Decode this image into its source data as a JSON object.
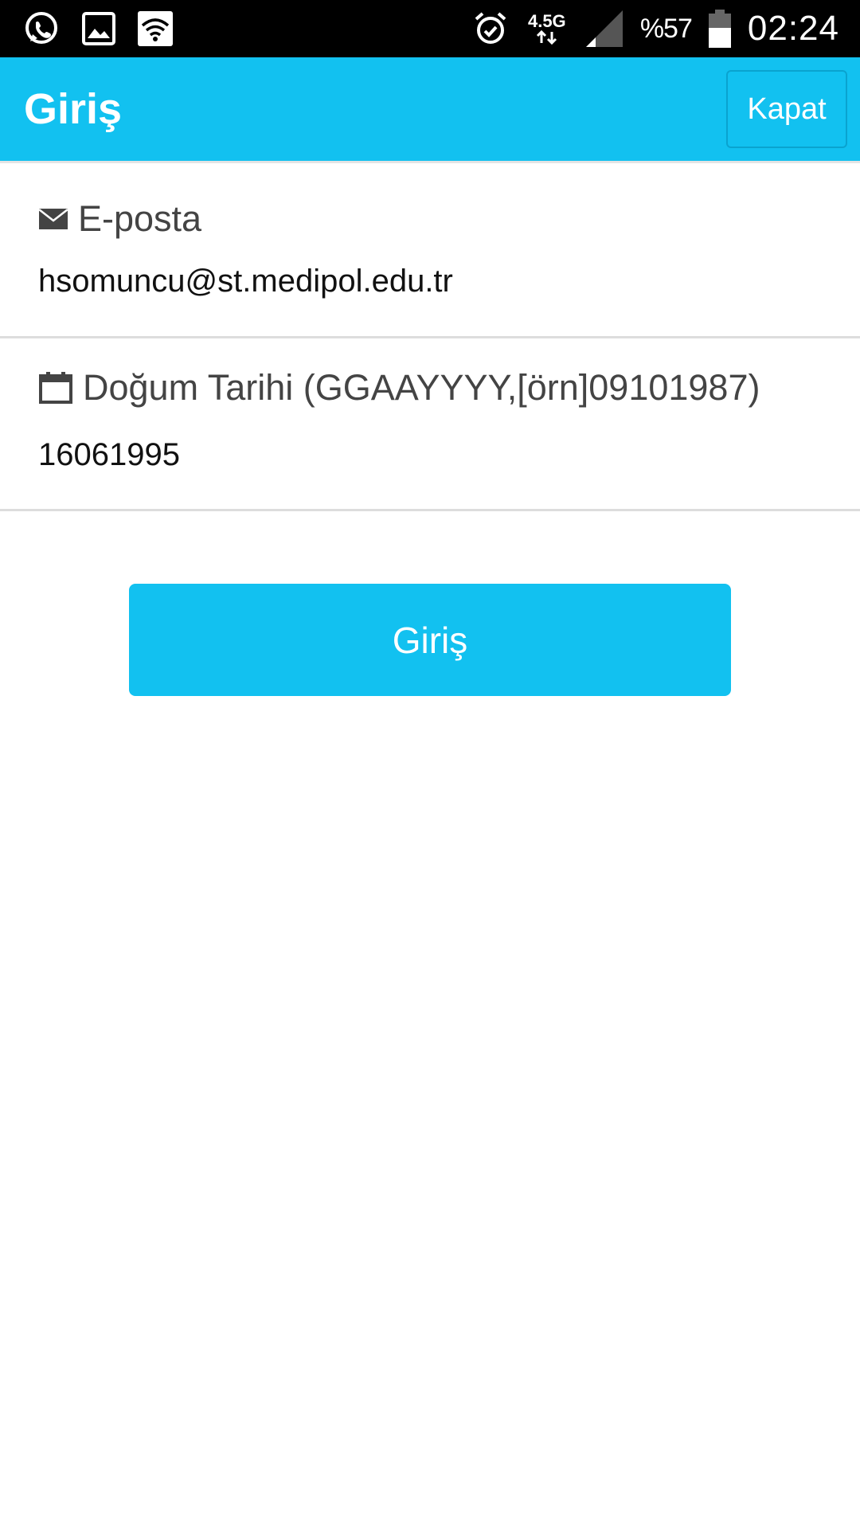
{
  "status_bar": {
    "left_icons": [
      "whatsapp-icon",
      "gallery-icon",
      "wifi-icon"
    ],
    "network_type": "4.5G",
    "battery_percent": "%57",
    "clock": "02:24"
  },
  "app_bar": {
    "title": "Giriş",
    "close_label": "Kapat",
    "color": "#12c1f0"
  },
  "form": {
    "email": {
      "label": "E-posta",
      "value": "hsomuncu@st.medipol.edu.tr",
      "icon": "envelope-icon"
    },
    "birth_date": {
      "label": "Doğum Tarihi (GGAAYYYY,[örn]09101987)",
      "value": "16061995",
      "icon": "calendar-icon"
    },
    "submit_label": "Giriş"
  }
}
